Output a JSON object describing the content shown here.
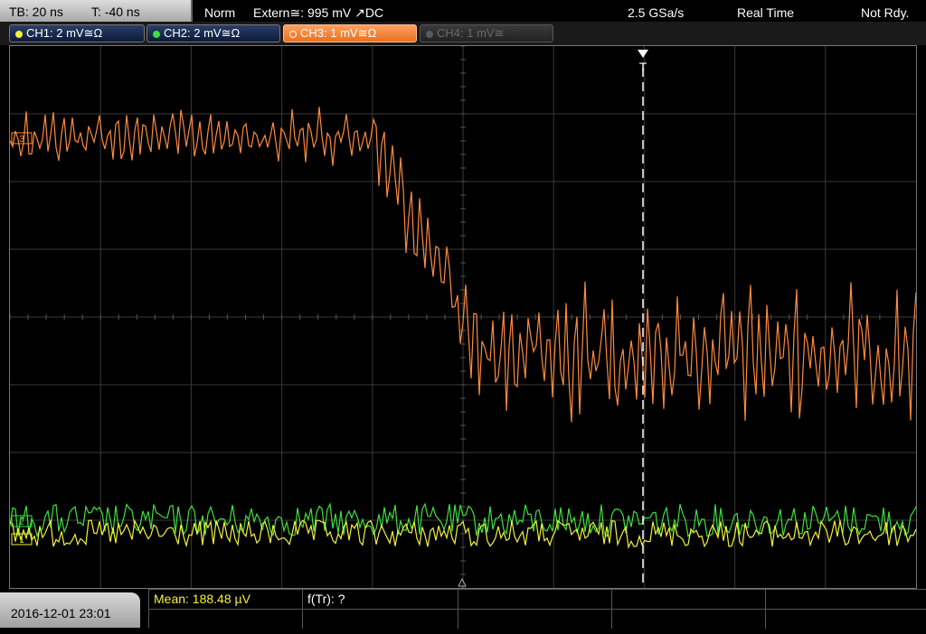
{
  "topbar": {
    "timebase": "TB: 20 ns",
    "trigger_time": "T: -40 ns",
    "mode": "Norm",
    "trigger_source": "Extern≅: 995 mV ↗DC",
    "sample_rate": "2.5 GSa/s",
    "acq_mode": "Real Time",
    "status": "Not Rdy."
  },
  "channels": [
    {
      "label": "CH1: 2 mV≅Ω",
      "color": "#f2f23a",
      "active": true
    },
    {
      "label": "CH2: 2 mV≅Ω",
      "color": "#3ee03e",
      "active": true
    },
    {
      "label": "CH3: 1 mV≅Ω",
      "color": "#ff8a3d",
      "active": true
    },
    {
      "label": "CH4: 1 mV≅",
      "color": "#8a8a8a",
      "active": false
    }
  ],
  "markers": {
    "trigger": "T",
    "ch1": "1",
    "ch2": "2",
    "ch3": "3"
  },
  "bottom": {
    "datetime": "2016-12-01 23:01",
    "mean": "Mean: 188.48 µV",
    "ftr": "f(Tr): ?"
  },
  "colors": {
    "ch1": "#f2f23a",
    "ch2": "#3ee03e",
    "ch3": "#ff8a3d",
    "grid": "#3a3a3a"
  }
}
